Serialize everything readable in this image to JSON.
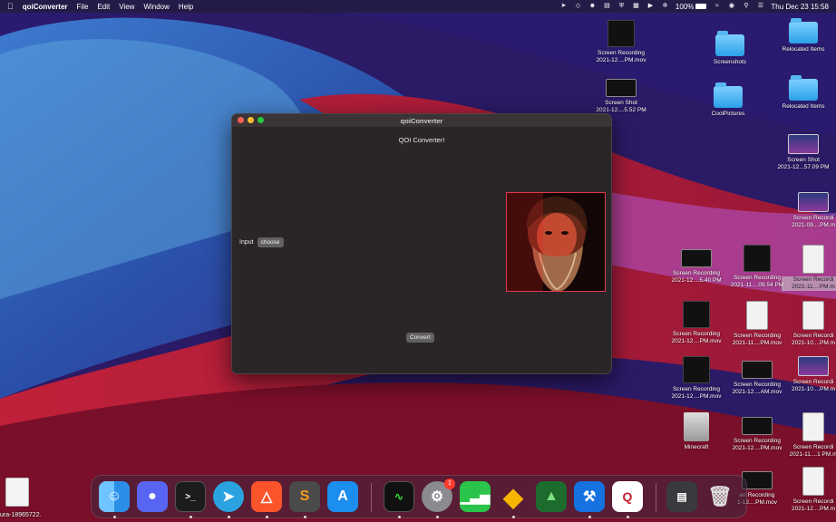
{
  "menubar": {
    "app_name": "qoiConverter",
    "menus": [
      "File",
      "Edit",
      "View",
      "Window",
      "Help"
    ],
    "battery": "100%",
    "datetime": "Thu Dec 23  15:58",
    "status_icons": [
      "telegram-icon",
      "sketch-icon",
      "user-icon",
      "vpn-icon",
      "shield-icon",
      "cpu-icon",
      "play-icon",
      "bluetooth-icon",
      "wifi-icon",
      "user-switch-icon",
      "search-icon",
      "control-center-icon"
    ]
  },
  "window": {
    "title": "qoiConverter",
    "heading": "QOI Converter!",
    "input_label": "Input",
    "choose_label": "choose",
    "convert_label": "Convert"
  },
  "desktop": {
    "items": [
      {
        "label": "Screen Recording\n2021-12....PM.mov"
      },
      {
        "label": "Screenshots"
      },
      {
        "label": "Relocated Items"
      },
      {
        "label": "Screen Shot\n2021-12....5.52 PM"
      },
      {
        "label": "CoolPictures"
      },
      {
        "label": "Relocated Items"
      },
      {
        "label": "Screen Shot\n2021-12...57.09 PM"
      },
      {
        "label": "Screen Recordi\n2021-09....PM.m"
      },
      {
        "label": "Screen Recording\n2021-12....5.40 PM"
      },
      {
        "label": "Screen Recording\n2021-11....09.54 PM"
      },
      {
        "label": "Screen Recordi\n2021-11....PM.m"
      },
      {
        "label": "Screen Recording\n2021-12....PM.mov"
      },
      {
        "label": "Screen Recording\n2021-11....PM.mov"
      },
      {
        "label": "Screen Recordi\n2021-10....PM.m"
      },
      {
        "label": "Screen Recording\n2021-12....PM.mov"
      },
      {
        "label": "Screen Recording\n2021-12....AM.mov"
      },
      {
        "label": "Screen Recordi\n2021-10....PM.m"
      },
      {
        "label": "Minecraft"
      },
      {
        "label": "Screen Recording\n2021-12....PM.mov"
      },
      {
        "label": "Screen Recordi\n2021-11....1 PM.m"
      },
      {
        "label": "en Recording\n1-12....PM.mov"
      },
      {
        "label": "Screen Recordi\n2021-12....PM.m"
      }
    ],
    "pdf_label": "ura-18965722."
  },
  "dock": {
    "apps": [
      {
        "name": "Finder",
        "icon": "finder-icon"
      },
      {
        "name": "Discord",
        "icon": "discord-icon"
      },
      {
        "name": "Terminal",
        "icon": "terminal-icon"
      },
      {
        "name": "Telegram",
        "icon": "telegram-icon"
      },
      {
        "name": "Brave",
        "icon": "brave-icon"
      },
      {
        "name": "Sublime Text",
        "icon": "sublime-icon"
      },
      {
        "name": "App Store",
        "icon": "app-store-icon"
      },
      {
        "name": "Activity Monitor",
        "icon": "activity-monitor-icon"
      },
      {
        "name": "System Preferences",
        "icon": "settings-icon",
        "badge": "1"
      },
      {
        "name": "Numbers",
        "icon": "numbers-icon"
      },
      {
        "name": "Sketch",
        "icon": "sketch-icon"
      },
      {
        "name": "Tower",
        "icon": "tower-icon"
      },
      {
        "name": "Xcode",
        "icon": "xcode-icon"
      },
      {
        "name": "qoiConverter",
        "icon": "qoi-converter-icon"
      },
      {
        "name": "Downloads",
        "icon": "downloads-icon"
      },
      {
        "name": "Trash",
        "icon": "trash-icon"
      }
    ]
  },
  "colors": {
    "window_bg": "#2a2628",
    "preview_border": "#e0364a",
    "close": "#ff5f57",
    "minimize": "#febc2e",
    "maximize": "#28c840"
  }
}
